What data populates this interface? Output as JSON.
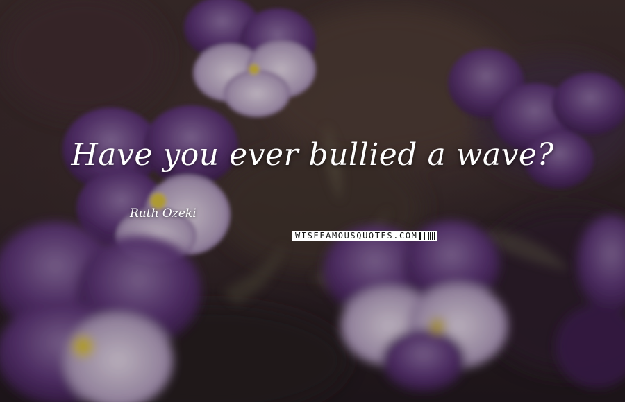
{
  "quote": {
    "text": "Have you ever bullied a wave?",
    "author": "Ruth Ozeki"
  },
  "watermark": {
    "text": "WISEFAMOUSQUOTES.COM"
  },
  "background": {
    "subject": "purple pansy flowers on dark blurred background",
    "colors": {
      "petal_dark": "#3a1d4d",
      "petal_mid": "#5b3478",
      "petal_light": "#8e72a6",
      "petal_pale": "#cdbfd6",
      "center_yellow": "#d9c23a",
      "backdrop": "#2c2124"
    }
  }
}
